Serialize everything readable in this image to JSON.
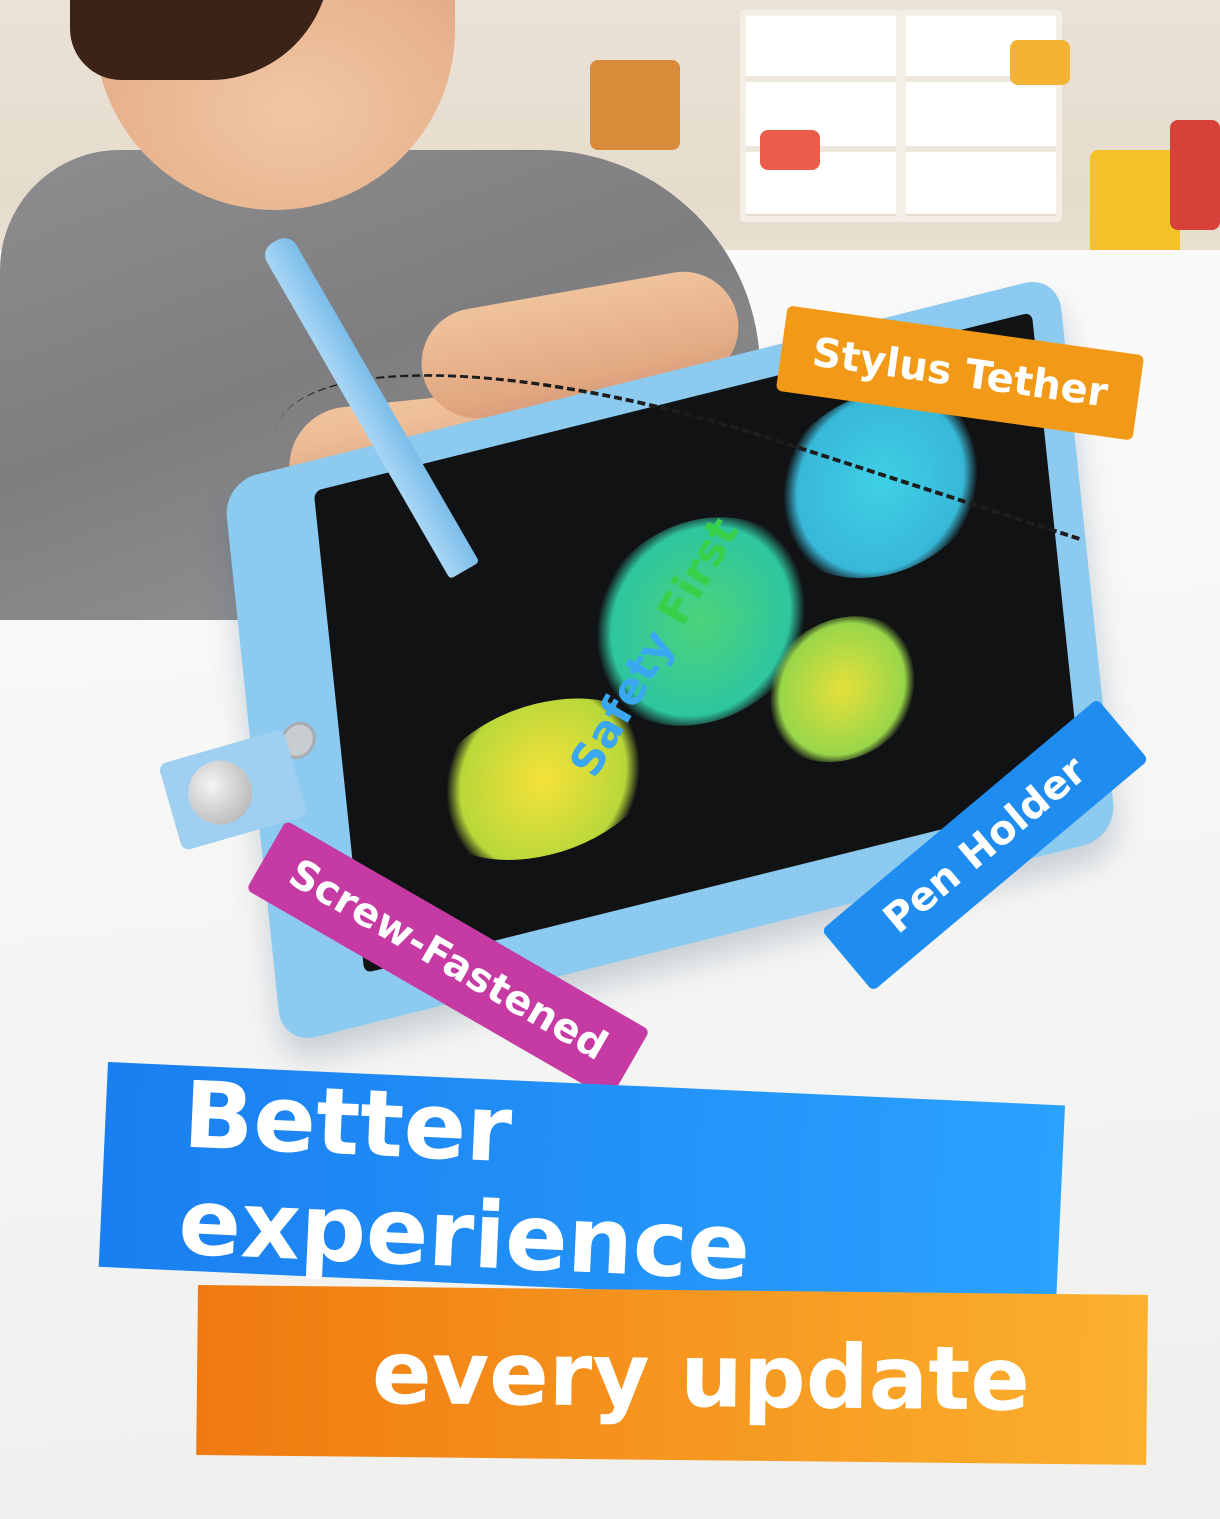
{
  "labels": {
    "stylus_tether": "Stylus Tether",
    "screw_fastened": "Screw-Fastened",
    "pen_holder": "Pen Holder"
  },
  "screen_text": {
    "word1": "Safety",
    "word2": "First"
  },
  "banners": {
    "line1": "Better experience",
    "line2": "every update"
  },
  "colors": {
    "stylus_tether_tag": "#f29a17",
    "screw_fastened_tag": "#c53aa3",
    "pen_holder_tag": "#1f8df0",
    "banner_blue": "#1a7ff0",
    "banner_orange": "#f07a10",
    "tablet_frame": "#8ccaf0"
  }
}
